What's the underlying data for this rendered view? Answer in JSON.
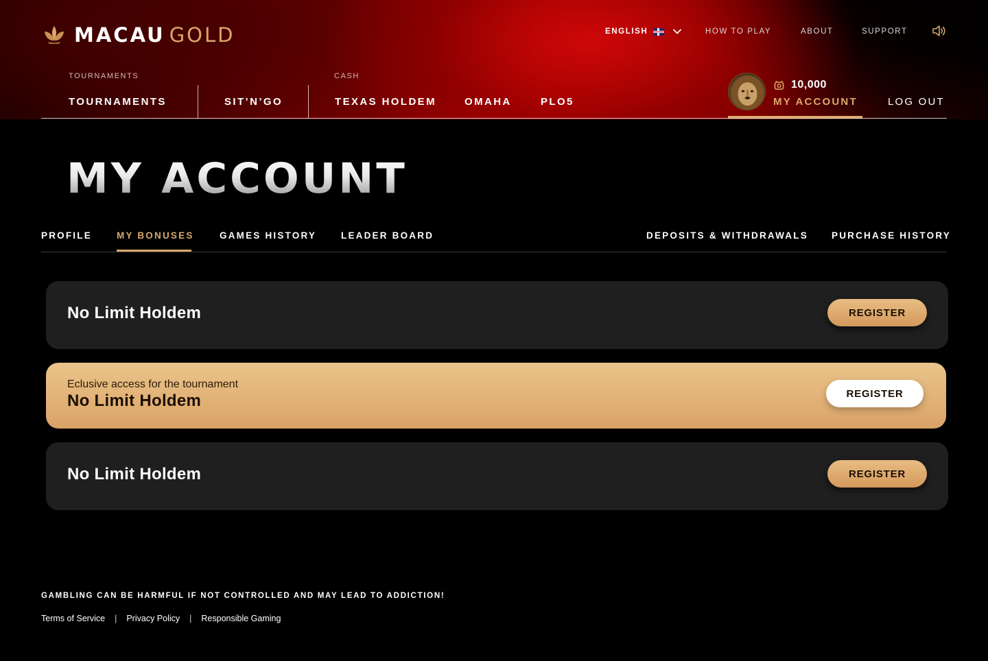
{
  "header": {
    "logo": {
      "part1": "MACAU",
      "part2": "GOLD"
    },
    "language": {
      "label": "ENGLISH",
      "flag": "uk-flag"
    },
    "links": {
      "how_to_play": "HOW TO PLAY",
      "about": "ABOUT",
      "support": "SUPPORT"
    },
    "categories": {
      "tournaments": "TOURNAMENTS",
      "cash": "CASH"
    },
    "nav": {
      "tournaments": "TOURNAMENTS",
      "sitngo": "SIT’N’GO",
      "texas_holdem": "TEXAS HOLDEM",
      "omaha": "OMAHA",
      "plo5": "PLO5"
    },
    "account": {
      "balance": "10,000",
      "my_account": "MY ACCOUNT",
      "logout": "LOG OUT"
    }
  },
  "page": {
    "title": "MY ACCOUNT"
  },
  "tabs": {
    "profile": "PROFILE",
    "my_bonuses": "MY BONUSES",
    "games_history": "GAMES HISTORY",
    "leader_board": "LEADER BOARD",
    "deposits": "DEPOSITS & WITHDRAWALS",
    "purchase_history": "PURCHASE HISTORY",
    "active": "my_bonuses"
  },
  "bonuses": [
    {
      "title": "No Limit Holdem",
      "button": "REGISTER"
    },
    {
      "subtitle": "Eclusive access for the tournament",
      "title": "No Limit Holdem",
      "button": "REGISTER"
    },
    {
      "title": "No Limit Holdem",
      "button": "REGISTER"
    }
  ],
  "footer": {
    "warning": "GAMBLING CAN BE HARMFUL IF NOT CONTROLLED AND MAY LEAD TO ADDICTION!",
    "terms": "Terms of Service",
    "privacy": "Privacy Policy",
    "responsible": "Responsible Gaming",
    "separator": "|"
  },
  "colors": {
    "accent": "#d9a86a",
    "card": "#1f1f1f",
    "header_red": "#a80000"
  }
}
